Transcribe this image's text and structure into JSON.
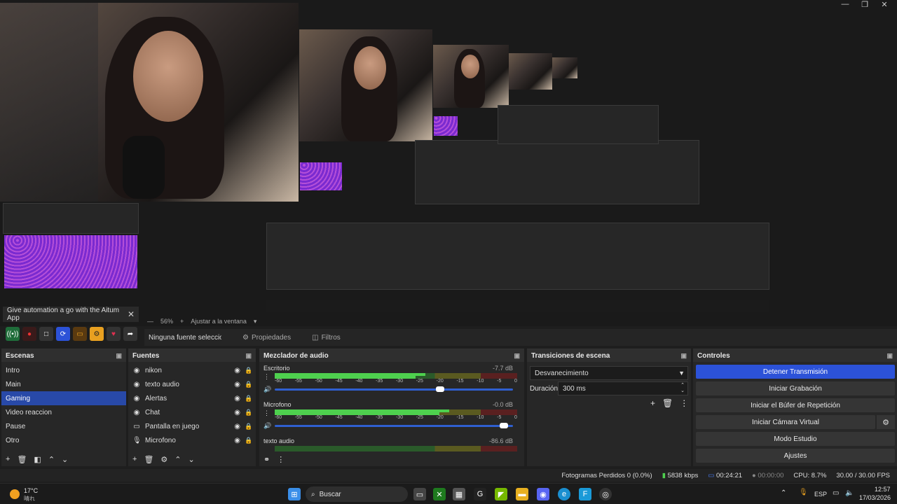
{
  "preview": {
    "ad_text": "Give automation a go with the Aitum App",
    "ad_close": "✕",
    "zoom_minus": "—",
    "zoom_level": "56%",
    "zoom_plus": "+",
    "zoom_fit": "Ajustar a la ventana",
    "zoom_dropdown": "▾"
  },
  "props_row": {
    "no_source": "Ninguna fuente seleccionac",
    "properties": "Propiedades",
    "filters": "Filtros"
  },
  "scenes": {
    "title": "Escenas",
    "items": [
      "Intro",
      "Main",
      "Gaming",
      "Video reaccion",
      "Pause",
      "Otro"
    ],
    "selected": "Gaming"
  },
  "sources": {
    "title": "Fuentes",
    "items": [
      {
        "label": "nikon",
        "icon": "camera-icon"
      },
      {
        "label": "texto audio",
        "icon": "audio-icon"
      },
      {
        "label": "Alertas",
        "icon": "browser-icon"
      },
      {
        "label": "Chat",
        "icon": "browser-icon"
      },
      {
        "label": "Pantalla en juego",
        "icon": "monitor-icon"
      },
      {
        "label": "Microfono",
        "icon": "mic-icon"
      }
    ]
  },
  "mixer": {
    "title": "Mezclador de audio",
    "scale": [
      "-60",
      "-55",
      "-50",
      "-45",
      "-40",
      "-35",
      "-30",
      "-25",
      "-20",
      "-15",
      "-10",
      "-5",
      "0"
    ],
    "channels": [
      {
        "name": "Escritorio",
        "db": "-7.7 dB",
        "level": 0.62,
        "volume": 0.7
      },
      {
        "name": "Microfono",
        "db": "-0.0 dB",
        "level": 0.72,
        "volume": 0.98
      },
      {
        "name": "texto audio",
        "db": "-86.6 dB",
        "level": 0.0,
        "volume": 0.5
      }
    ]
  },
  "transitions": {
    "title": "Transiciones de escena",
    "current": "Desvanecimiento",
    "duration_label": "Duración",
    "duration_value": "300 ms"
  },
  "controls": {
    "title": "Controles",
    "stop_stream": "Detener Transmisión",
    "start_record": "Iniciar Grabación",
    "replay_buffer": "Iniciar el Búfer de Repetición",
    "virtual_cam": "Iniciar Cámara Virtual",
    "studio_mode": "Modo Estudio",
    "settings": "Ajustes"
  },
  "status": {
    "dropped": "Fotogramas Perdidos 0 (0.0%)",
    "bitrate": "5838 kbps",
    "stream_time": "00:24:21",
    "record_time": "00:00:00",
    "cpu": "CPU: 8.7%",
    "fps": "30.00 / 30.00 FPS"
  },
  "taskbar": {
    "temp": "17°C",
    "weather": "晴れ",
    "search": "Buscar",
    "lang": "ESP",
    "time": "12:57",
    "date": "17/03/2026"
  },
  "colors": {
    "accent": "#2c52d8",
    "selected": "#2849a8",
    "meter_green": "#4ed04e"
  }
}
